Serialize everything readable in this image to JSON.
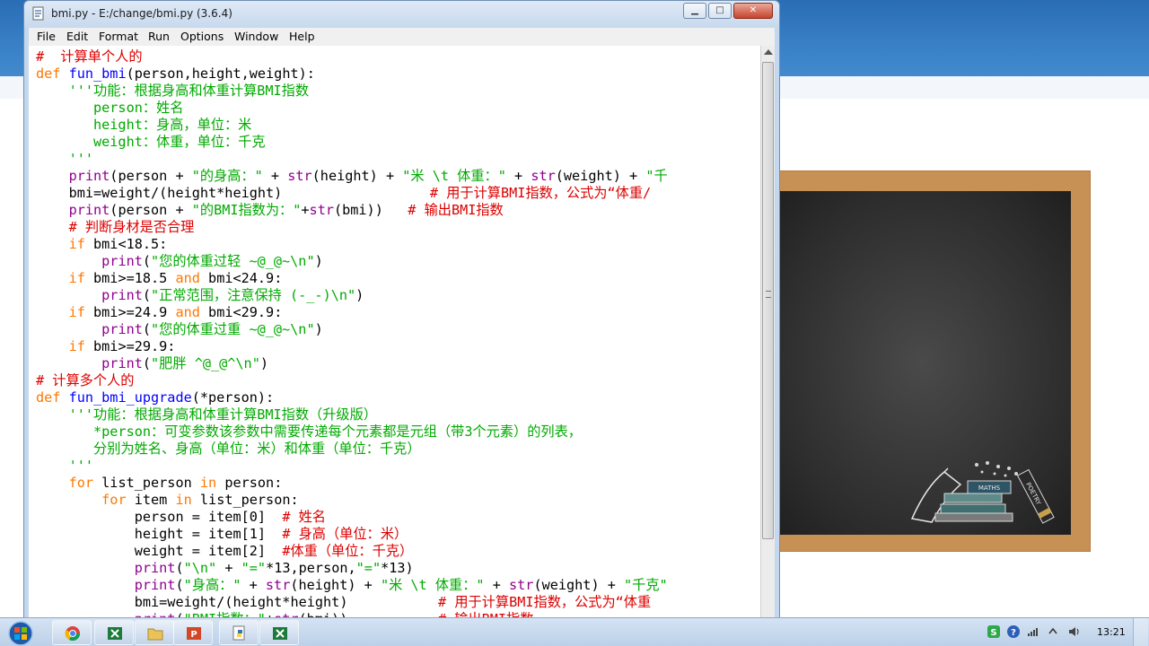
{
  "window": {
    "title": "bmi.py - E:/change/bmi.py (3.6.4)",
    "min_glyph": "▁",
    "max_glyph": "□",
    "close_glyph": "✕"
  },
  "menu": [
    "File",
    "Edit",
    "Format",
    "Run",
    "Options",
    "Window",
    "Help"
  ],
  "code_lines": [
    [
      [
        "cm",
        "#  计算单个人的"
      ]
    ],
    [
      [
        "kw",
        "def "
      ],
      [
        "fn",
        "fun_bmi"
      ],
      [
        "",
        "(person,height,weight):"
      ]
    ],
    [
      [
        "st",
        "    '''功能：根据身高和体重计算BMI指数"
      ]
    ],
    [
      [
        "st",
        "       person：姓名"
      ]
    ],
    [
      [
        "st",
        "       height：身高，单位：米"
      ]
    ],
    [
      [
        "st",
        "       weight：体重，单位：千克"
      ]
    ],
    [
      [
        "st",
        "    '''"
      ]
    ],
    [
      [
        "",
        "    "
      ],
      [
        "bi",
        "print"
      ],
      [
        "",
        "(person + "
      ],
      [
        "st",
        "\"的身高：\""
      ],
      [
        "",
        " + "
      ],
      [
        "bi",
        "str"
      ],
      [
        "",
        "(height) + "
      ],
      [
        "st",
        "\"米 \\t 体重：\""
      ],
      [
        "",
        " + "
      ],
      [
        "bi",
        "str"
      ],
      [
        "",
        "(weight) + "
      ],
      [
        "st",
        "\"千"
      ]
    ],
    [
      [
        "",
        "    bmi=weight/(height*height)                  "
      ],
      [
        "cm",
        "# 用于计算BMI指数，公式为“体重/"
      ]
    ],
    [
      [
        "",
        "    "
      ],
      [
        "bi",
        "print"
      ],
      [
        "",
        "(person + "
      ],
      [
        "st",
        "\"的BMI指数为：\""
      ],
      [
        "",
        "+"
      ],
      [
        "bi",
        "str"
      ],
      [
        "",
        "(bmi))   "
      ],
      [
        "cm",
        "# 输出BMI指数"
      ]
    ],
    [
      [
        "cm",
        "    # 判断身材是否合理"
      ]
    ],
    [
      [
        "",
        "    "
      ],
      [
        "kw",
        "if"
      ],
      [
        "",
        " bmi<18.5:"
      ]
    ],
    [
      [
        "",
        "        "
      ],
      [
        "bi",
        "print"
      ],
      [
        "",
        "("
      ],
      [
        "st",
        "\"您的体重过轻 ~@_@~\\n\""
      ],
      [
        "",
        ")"
      ]
    ],
    [
      [
        "",
        "    "
      ],
      [
        "kw",
        "if"
      ],
      [
        "",
        " bmi>=18.5 "
      ],
      [
        "kw",
        "and"
      ],
      [
        "",
        " bmi<24.9:"
      ]
    ],
    [
      [
        "",
        "        "
      ],
      [
        "bi",
        "print"
      ],
      [
        "",
        "("
      ],
      [
        "st",
        "\"正常范围，注意保持 (-_-)\\n\""
      ],
      [
        "",
        ")"
      ]
    ],
    [
      [
        "",
        "    "
      ],
      [
        "kw",
        "if"
      ],
      [
        "",
        " bmi>=24.9 "
      ],
      [
        "kw",
        "and"
      ],
      [
        "",
        " bmi<29.9:"
      ]
    ],
    [
      [
        "",
        "        "
      ],
      [
        "bi",
        "print"
      ],
      [
        "",
        "("
      ],
      [
        "st",
        "\"您的体重过重 ~@_@~\\n\""
      ],
      [
        "",
        ")"
      ]
    ],
    [
      [
        "",
        "    "
      ],
      [
        "kw",
        "if"
      ],
      [
        "",
        " bmi>=29.9:"
      ]
    ],
    [
      [
        "",
        "        "
      ],
      [
        "bi",
        "print"
      ],
      [
        "",
        "("
      ],
      [
        "st",
        "\"肥胖 ^@_@^\\n\""
      ],
      [
        "",
        ")"
      ]
    ],
    [
      [
        "cm",
        "# 计算多个人的"
      ]
    ],
    [
      [
        "kw",
        "def "
      ],
      [
        "fn",
        "fun_bmi_upgrade"
      ],
      [
        "",
        "(*person):"
      ]
    ],
    [
      [
        "st",
        "    '''功能：根据身高和体重计算BMI指数（升级版）"
      ]
    ],
    [
      [
        "st",
        "       *person：可变参数该参数中需要传递每个元素都是元组（带3个元素）的列表，"
      ]
    ],
    [
      [
        "st",
        "       分别为姓名、身高（单位：米）和体重（单位：千克）"
      ]
    ],
    [
      [
        "st",
        "    '''"
      ]
    ],
    [
      [
        "",
        "    "
      ],
      [
        "kw",
        "for"
      ],
      [
        "",
        " list_person "
      ],
      [
        "kw",
        "in"
      ],
      [
        "",
        " person:"
      ]
    ],
    [
      [
        "",
        "        "
      ],
      [
        "kw",
        "for"
      ],
      [
        "",
        " item "
      ],
      [
        "kw",
        "in"
      ],
      [
        "",
        " list_person:"
      ]
    ],
    [
      [
        "",
        "            person = item[0]  "
      ],
      [
        "cm",
        "# 姓名"
      ]
    ],
    [
      [
        "",
        "            height = item[1]  "
      ],
      [
        "cm",
        "# 身高（单位：米）"
      ]
    ],
    [
      [
        "",
        "            weight = item[2]  "
      ],
      [
        "cm",
        "#体重（单位：千克）"
      ]
    ],
    [
      [
        "",
        "            "
      ],
      [
        "bi",
        "print"
      ],
      [
        "",
        "("
      ],
      [
        "st",
        "\"\\n\""
      ],
      [
        "",
        " + "
      ],
      [
        "st",
        "\"=\""
      ],
      [
        "",
        "*13,person,"
      ],
      [
        "st",
        "\"=\""
      ],
      [
        "",
        "*13)"
      ]
    ],
    [
      [
        "",
        "            "
      ],
      [
        "bi",
        "print"
      ],
      [
        "",
        "("
      ],
      [
        "st",
        "\"身高：\""
      ],
      [
        "",
        " + "
      ],
      [
        "bi",
        "str"
      ],
      [
        "",
        "(height) + "
      ],
      [
        "st",
        "\"米 \\t 体重：\""
      ],
      [
        "",
        " + "
      ],
      [
        "bi",
        "str"
      ],
      [
        "",
        "(weight) + "
      ],
      [
        "st",
        "\"千克\""
      ]
    ],
    [
      [
        "",
        "            bmi=weight/(height*height)           "
      ],
      [
        "cm",
        "# 用于计算BMI指数，公式为“体重"
      ]
    ],
    [
      [
        "",
        "            "
      ],
      [
        "bi",
        "print"
      ],
      [
        "",
        "("
      ],
      [
        "st",
        "\"BMI指数：\""
      ],
      [
        "",
        "+"
      ],
      [
        "bi",
        "str"
      ],
      [
        "",
        "(bmi))           "
      ],
      [
        "cm",
        "# 输出BMI指数"
      ]
    ]
  ],
  "taskbar": {
    "clock": "13:21",
    "apps": [
      "chrome-icon",
      "excel-icon",
      "explorer-icon",
      "powerpoint-icon",
      "python-icon",
      "excel-icon-2"
    ]
  },
  "board": {
    "books_label_1": "MATHS",
    "books_label_2": "POETRY"
  }
}
